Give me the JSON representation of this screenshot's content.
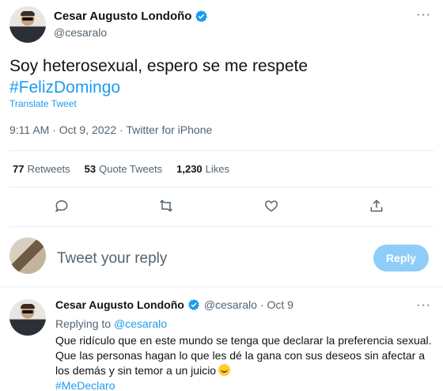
{
  "main_tweet": {
    "display_name": "Cesar Augusto Londoño",
    "handle": "@cesaralo",
    "text": "Soy heterosexual, espero se me respete",
    "hashtag": "#FelizDomingo",
    "translate_label": "Translate Tweet",
    "meta": "9:11 AM · Oct 9, 2022 · Twitter for iPhone",
    "more_icon": "···"
  },
  "stats": {
    "retweets_count": "77",
    "retweets_label": "Retweets",
    "quotes_count": "53",
    "quotes_label": "Quote Tweets",
    "likes_count": "1,230",
    "likes_label": "Likes"
  },
  "actions": {
    "icons": [
      "comment-icon",
      "retweet-icon",
      "heart-icon",
      "share-icon"
    ]
  },
  "composer": {
    "placeholder": "Tweet your reply",
    "reply_button": "Reply"
  },
  "reply_tweet": {
    "display_name": "Cesar Augusto Londoño",
    "handle": "@cesaralo",
    "date": "· Oct 9",
    "replying_prefix": "Replying to ",
    "replying_handle": "@cesaralo",
    "text": "Que ridículo que en este mundo se tenga que declarar la preferencia sexual. Que las personas hagan lo que les dé la gana con sus deseos sin afectar a los demás y sin temor a un juicio",
    "hashtag": "#MeDeclaro",
    "more_icon": "···"
  },
  "colors": {
    "accent": "#1d9bf0",
    "reply_button_disabled": "#8ecdf7",
    "secondary_text": "#536471"
  }
}
